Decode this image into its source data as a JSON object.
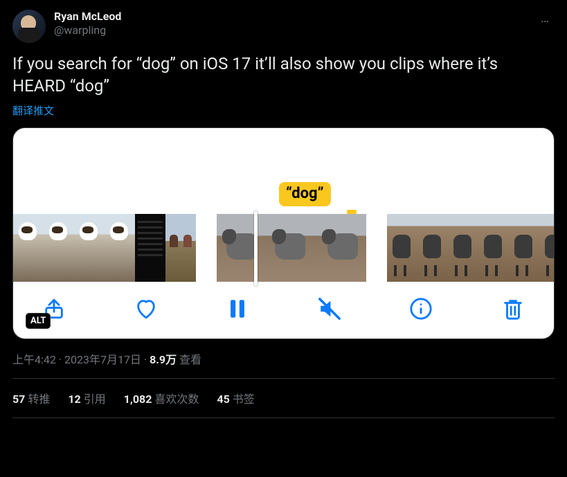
{
  "author": {
    "name": "Ryan McLeod",
    "handle": "@warpling"
  },
  "more_icon": "…",
  "tweet_text": "If you search for “dog” on iOS 17 it’ll also show you clips where it’s HEARD “dog”",
  "translate_label": "翻译推文",
  "media": {
    "keyword": "“dog”",
    "alt_badge": "ALT"
  },
  "meta": {
    "time": "上午4:42",
    "sep1": " · ",
    "date": "2023年7月17日",
    "sep2": " · ",
    "views_count": "8.9万",
    "views_label": " 查看"
  },
  "stats": {
    "retweets": {
      "count": "57",
      "label": "转推"
    },
    "quotes": {
      "count": "12",
      "label": "引用"
    },
    "likes": {
      "count": "1,082",
      "label": "喜欢次数"
    },
    "bookmarks": {
      "count": "45",
      "label": "书签"
    }
  }
}
